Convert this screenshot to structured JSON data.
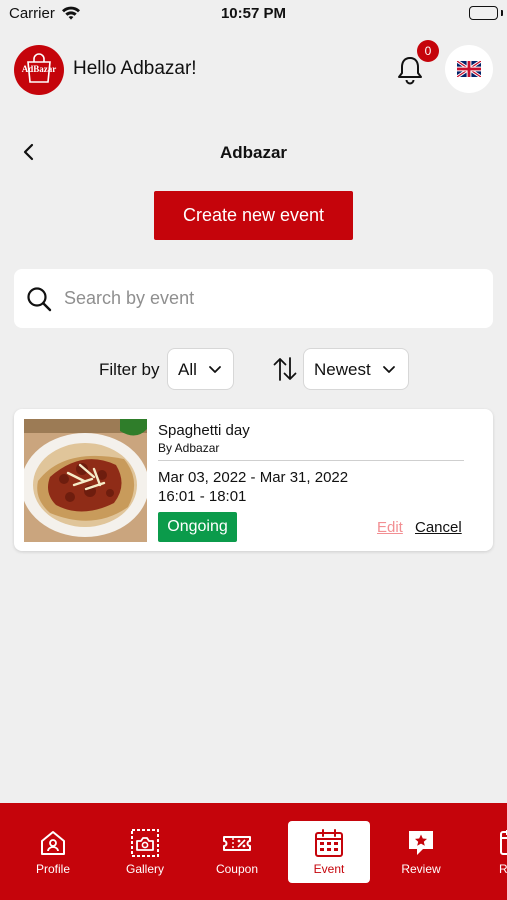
{
  "status_bar": {
    "carrier": "Carrier",
    "time": "10:57 PM"
  },
  "header": {
    "logo_text": "AdBazar",
    "greeting": "Hello Adbazar!",
    "notification_count": "0",
    "language": "English (UK flag)"
  },
  "nav": {
    "title": "Adbazar"
  },
  "actions": {
    "create_event": "Create new event"
  },
  "search": {
    "placeholder": "Search by event"
  },
  "filter": {
    "label": "Filter by",
    "selected": "All"
  },
  "sort": {
    "selected": "Newest"
  },
  "events": [
    {
      "title": "Spaghetti day",
      "by": "By Adbazar",
      "date_range": "Mar 03, 2022 - Mar 31, 2022",
      "time_range": "16:01 - 18:01",
      "status": "Ongoing",
      "edit_label": "Edit",
      "cancel_label": "Cancel"
    }
  ],
  "tabs": [
    {
      "label": "Profile",
      "icon": "profile-icon"
    },
    {
      "label": "Gallery",
      "icon": "gallery-icon"
    },
    {
      "label": "Coupon",
      "icon": "coupon-icon"
    },
    {
      "label": "Event",
      "icon": "calendar-icon",
      "active": true
    },
    {
      "label": "Review",
      "icon": "review-icon"
    },
    {
      "label": "Rese",
      "icon": "reservation-icon"
    }
  ],
  "colors": {
    "brand": "#c5040b",
    "status_ongoing": "#0b9b4b",
    "edit_link": "#f28f93",
    "background": "#efefef"
  }
}
